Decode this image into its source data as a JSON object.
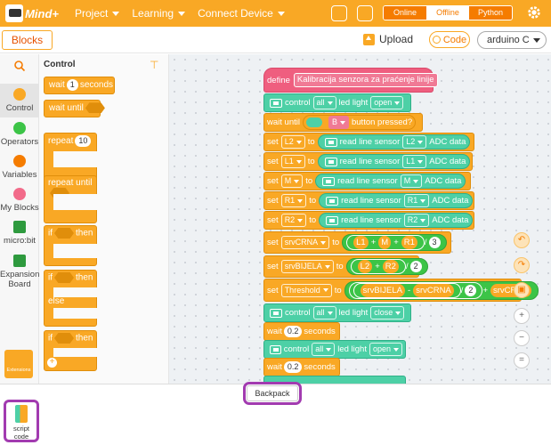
{
  "app": {
    "logo_text": "Mind+"
  },
  "menu": [
    "Project",
    "Learning",
    "Connect Device"
  ],
  "modes": [
    "Online",
    "Offline",
    "Python"
  ],
  "active_mode": "Offline",
  "toolbar": {
    "blocks_tab": "Blocks",
    "upload": "Upload",
    "code": "Code",
    "device": "arduino C"
  },
  "categories": [
    {
      "label": "Control",
      "color": "#f9a825"
    },
    {
      "label": "Operators",
      "color": "#3cc447"
    },
    {
      "label": "Variables",
      "color": "#f57c00"
    },
    {
      "label": "My Blocks",
      "color": "#f26b8a"
    },
    {
      "label": "micro:bit",
      "color": "#2e9a3e"
    },
    {
      "label": "Expansion Board",
      "color": "#2e9a3e"
    }
  ],
  "extensions_label": "Extensions",
  "flyout": {
    "title": "Control",
    "wait_label": "wait",
    "wait_value": "1",
    "seconds": "seconds",
    "wait_until": "wait until",
    "repeat": "repeat",
    "repeat_value": "10",
    "repeat_until": "repeat until",
    "if1": "if",
    "then1": "then",
    "if2": "if",
    "then2": "then",
    "else": "else",
    "if3": "if",
    "then3": "then"
  },
  "script": {
    "define": "define",
    "define_name": "Kalibracija senzora za praćenje linije",
    "control": "control",
    "all": "all",
    "led_light": "led light",
    "open": "open",
    "close": "close",
    "wait_until": "wait until",
    "button_b": "B",
    "button_pressed": "button pressed?",
    "set": "set",
    "to": "to",
    "read_line_sensor": "read line sensor",
    "adc_data": "ADC data",
    "sensors": [
      "L2",
      "L1",
      "M",
      "R1",
      "R2"
    ],
    "srvcrna": "srvCRNA",
    "srvbijela": "srvBIJELA",
    "threshold": "Threshold",
    "plus": "+",
    "minus": "-",
    "divide": "/",
    "three": "3",
    "two": "2",
    "wait": "wait",
    "wait_value": "0.2",
    "seconds": "seconds"
  },
  "backpack": {
    "tab": "Backpack",
    "item_label": "script code"
  }
}
